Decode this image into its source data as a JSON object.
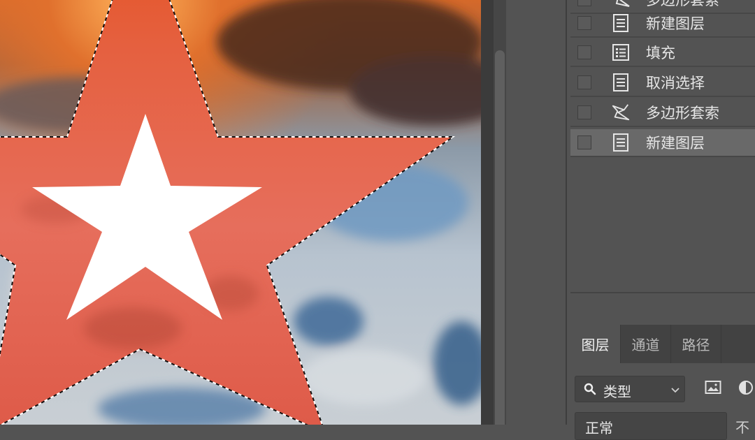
{
  "history": {
    "items": [
      {
        "label": "多边形套索",
        "icon": "lasso-icon",
        "selected": false
      },
      {
        "label": "新建图层",
        "icon": "document-icon",
        "selected": false
      },
      {
        "label": "填充",
        "icon": "fill-document-icon",
        "selected": false
      },
      {
        "label": "取消选择",
        "icon": "document-icon",
        "selected": false
      },
      {
        "label": "多边形套索",
        "icon": "lasso-icon",
        "selected": false
      },
      {
        "label": "新建图层",
        "icon": "document-icon",
        "selected": true
      }
    ]
  },
  "layers_panel": {
    "tabs": [
      {
        "label": "图层",
        "active": true
      },
      {
        "label": "通道",
        "active": false
      },
      {
        "label": "路径",
        "active": false
      }
    ],
    "filter_kind": "类型",
    "blend_mode": "正常",
    "opacity_label": "不"
  },
  "colors": {
    "panel_bg": "#535353",
    "selected_row": "#696969",
    "tab_bar": "#424242",
    "selection_fill": "#e8604a"
  }
}
